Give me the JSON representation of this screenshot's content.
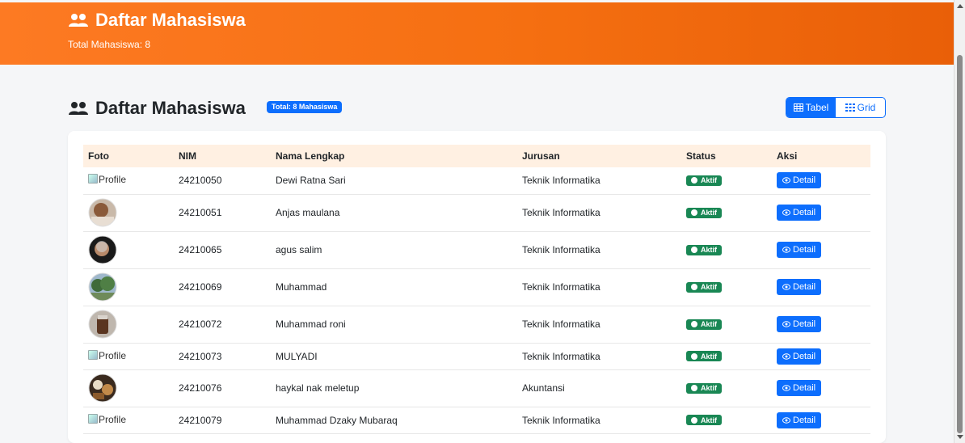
{
  "header": {
    "title": "Daftar Mahasiswa",
    "subtitle": "Total Mahasiswa: 8"
  },
  "main": {
    "title": "Daftar Mahasiswa",
    "total_badge": "Total: 8 Mahasiswa",
    "view_toggle": {
      "table_label": "Tabel",
      "grid_label": "Grid",
      "active": "Tabel"
    }
  },
  "table": {
    "headers": {
      "foto": "Foto",
      "nim": "NIM",
      "nama": "Nama Lengkap",
      "jurusan": "Jurusan",
      "status": "Status",
      "aksi": "Aksi"
    },
    "rows": [
      {
        "foto": "broken",
        "foto_alt": "Profile",
        "nim": "24210050",
        "nama": "Dewi Ratna Sari",
        "jurusan": "Teknik Informatika",
        "status": "Aktif",
        "action": "Detail"
      },
      {
        "foto": "photo",
        "nim": "24210051",
        "nama": "Anjas maulana",
        "jurusan": "Teknik Informatika",
        "status": "Aktif",
        "action": "Detail"
      },
      {
        "foto": "photo",
        "nim": "24210065",
        "nama": "agus salim",
        "jurusan": "Teknik Informatika",
        "status": "Aktif",
        "action": "Detail"
      },
      {
        "foto": "photo",
        "nim": "24210069",
        "nama": "Muhammad",
        "jurusan": "Teknik Informatika",
        "status": "Aktif",
        "action": "Detail"
      },
      {
        "foto": "photo",
        "nim": "24210072",
        "nama": "Muhammad roni",
        "jurusan": "Teknik Informatika",
        "status": "Aktif",
        "action": "Detail"
      },
      {
        "foto": "broken",
        "foto_alt": "Profile",
        "nim": "24210073",
        "nama": "MULYADI",
        "jurusan": "Teknik Informatika",
        "status": "Aktif",
        "action": "Detail"
      },
      {
        "foto": "photo",
        "nim": "24210076",
        "nama": "haykal nak meletup",
        "jurusan": "Akuntansi",
        "status": "Aktif",
        "action": "Detail"
      },
      {
        "foto": "broken",
        "foto_alt": "Profile",
        "nim": "24210079",
        "nama": "Muhammad Dzaky Mubaraq",
        "jurusan": "Teknik Informatika",
        "status": "Aktif",
        "action": "Detail"
      }
    ]
  },
  "colors": {
    "header_orange": "#f56f11",
    "primary_blue": "#0d6efd",
    "status_green": "#198754",
    "table_header_bg": "#fff0e2"
  },
  "icons": {
    "title": "users-icon",
    "table_view": "table-icon",
    "grid_view": "grid-icon",
    "status": "toggle-on-icon",
    "detail": "eye-icon"
  }
}
